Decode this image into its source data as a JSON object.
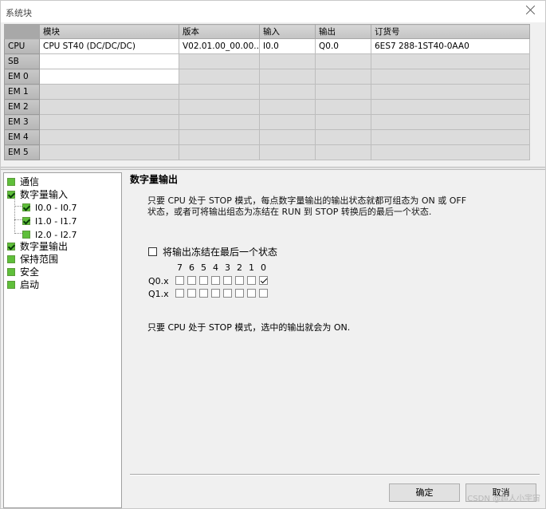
{
  "window": {
    "title": "系统块"
  },
  "grid": {
    "columns": [
      "模块",
      "版本",
      "输入",
      "输出",
      "订货号"
    ],
    "rows": [
      {
        "label": "CPU",
        "module": "CPU ST40 (DC/DC/DC)",
        "version": "V02.01.00_00.00...",
        "input": "I0.0",
        "output": "Q0.0",
        "order": "6ES7 288-1ST40-0AA0"
      },
      {
        "label": "SB",
        "module": "",
        "version": "",
        "input": "",
        "output": "",
        "order": ""
      },
      {
        "label": "EM 0",
        "module": "",
        "version": "",
        "input": "",
        "output": "",
        "order": ""
      },
      {
        "label": "EM 1",
        "module": "",
        "version": "",
        "input": "",
        "output": "",
        "order": ""
      },
      {
        "label": "EM 2",
        "module": "",
        "version": "",
        "input": "",
        "output": "",
        "order": ""
      },
      {
        "label": "EM 3",
        "module": "",
        "version": "",
        "input": "",
        "output": "",
        "order": ""
      },
      {
        "label": "EM 4",
        "module": "",
        "version": "",
        "input": "",
        "output": "",
        "order": ""
      },
      {
        "label": "EM 5",
        "module": "",
        "version": "",
        "input": "",
        "output": "",
        "order": ""
      }
    ]
  },
  "tree": {
    "comm": "通信",
    "dinput": "数字量输入",
    "d0": "I0.0 - I0.7",
    "d1": "I1.0 - I1.7",
    "d2": "I2.0 - I2.7",
    "doutput": "数字量输出",
    "retain": "保持范围",
    "security": "安全",
    "startup": "启动"
  },
  "panel": {
    "title": "数字量输出",
    "desc_line1": "只要 CPU 处于 STOP 模式，每点数字量输出的输出状态就都可组态为 ON 或 OFF",
    "desc_line2": "状态，或者可将输出组态为冻结在 RUN 到 STOP 转换后的最后一个状态.",
    "freeze_label": "将输出冻结在最后一个状态",
    "bits": [
      "7",
      "6",
      "5",
      "4",
      "3",
      "2",
      "1",
      "0"
    ],
    "rows": [
      {
        "label": "Q0.x",
        "checked": [
          false,
          false,
          false,
          false,
          false,
          false,
          false,
          true
        ]
      },
      {
        "label": "Q1.x",
        "checked": [
          false,
          false,
          false,
          false,
          false,
          false,
          false,
          false
        ]
      }
    ],
    "note": "只要 CPU 处于 STOP 模式，选中的输出就会为 ON."
  },
  "buttons": {
    "ok": "确定",
    "cancel": "取消"
  },
  "watermark": "CSDN @超人小宇宙"
}
